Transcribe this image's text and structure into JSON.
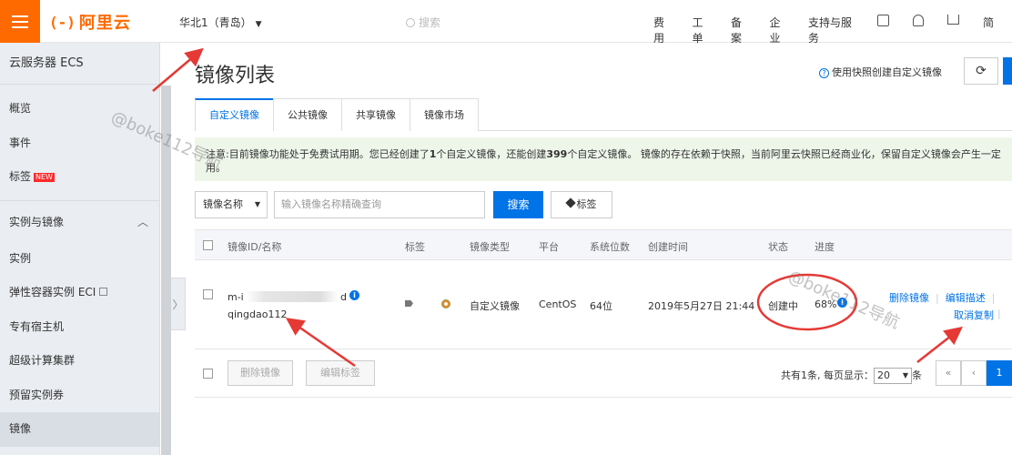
{
  "header": {
    "logo_mark": "(-)",
    "logo_text": "阿里云",
    "region": "华北1（青岛）",
    "search_placeholder": "搜索",
    "nav": [
      "费用",
      "工单",
      "备案",
      "企业",
      "支持与服务"
    ],
    "nav_tail": "简"
  },
  "sidebar": {
    "title": "云服务器 ECS",
    "top_items": [
      {
        "label": "概览"
      },
      {
        "label": "事件"
      },
      {
        "label": "标签",
        "badge": "NEW"
      }
    ],
    "section": "实例与镜像",
    "section_items": [
      {
        "label": "实例"
      },
      {
        "label": "弹性容器实例 ECI"
      },
      {
        "label": "专有宿主机"
      },
      {
        "label": "超级计算集群"
      },
      {
        "label": "预留实例券"
      },
      {
        "label": "镜像"
      }
    ],
    "collapse_glyph": "〉"
  },
  "main": {
    "title": "镜像列表",
    "help_link": "使用快照创建自定义镜像",
    "refresh_glyph": "⟳",
    "tabs": [
      "自定义镜像",
      "公共镜像",
      "共享镜像",
      "镜像市场"
    ],
    "notice": {
      "p1": "注意:目前镜像功能处于免费试用期。您已经创建了",
      "n1": "1",
      "p2": "个自定义镜像，还能创建",
      "n2": "399",
      "p3": "个自定义镜像。 镜像的存在依赖于快照，当前阿里云快照已经商业化，保留自定义镜像会产生一定",
      "p4": "用。"
    },
    "filter": {
      "select": "镜像名称",
      "input_placeholder": "输入镜像名称精确查询",
      "search_button": "搜索",
      "tag_button": "标签"
    },
    "table": {
      "headers": [
        "镜像ID/名称",
        "标签",
        "镜像类型",
        "平台",
        "系统位数",
        "创建时间",
        "状态",
        "进度"
      ],
      "row": {
        "id_prefix": "m-i",
        "id_suffix": "d",
        "name": "qingdao112",
        "type": "自定义镜像",
        "platform": "CentOS",
        "bits": "64位",
        "created": "2019年5月27日 21:44",
        "status": "创建中",
        "progress": "68%",
        "actions": [
          "删除镜像",
          "编辑描述",
          "取消复制"
        ]
      }
    },
    "footer": {
      "delete_button": "删除镜像",
      "edit_tags_button": "编辑标签",
      "total_prefix": "共有1条, 每页显示：",
      "page_size": "20",
      "total_suffix": "条",
      "first": "«",
      "prev": "‹",
      "current_page": "1"
    }
  },
  "watermark": "@boke112导航",
  "colors": {
    "accent": "#ff6a00",
    "primary": "#0073e6",
    "annotation": "#e53935"
  }
}
